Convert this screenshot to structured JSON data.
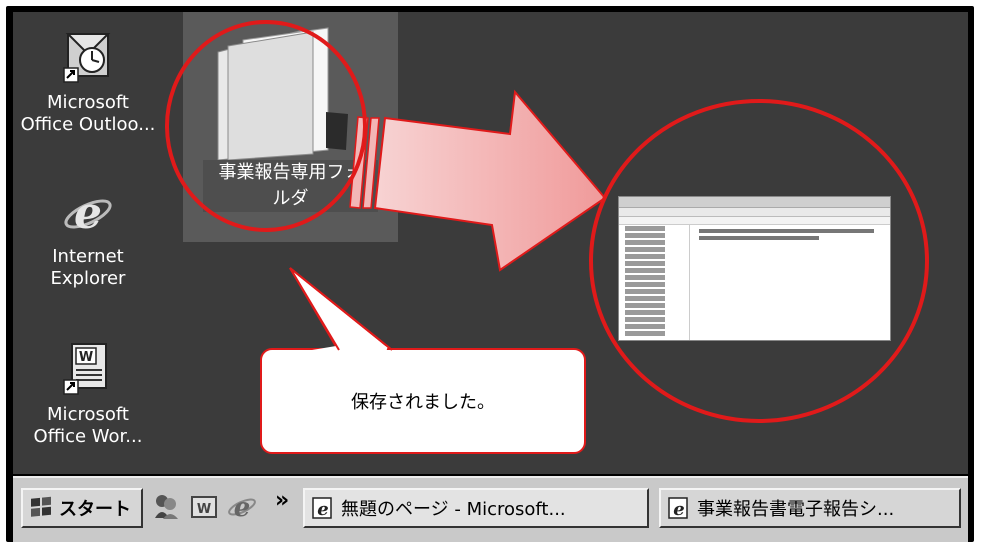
{
  "desktop": {
    "icons": [
      {
        "label_line1": "Microsoft",
        "label_line2": "Office Outloo..."
      },
      {
        "label_line1": "Internet",
        "label_line2": "Explorer"
      },
      {
        "label_line1": "Microsoft",
        "label_line2": "Office Wor..."
      }
    ],
    "folder": {
      "label_line1": "事業報告専用フォ",
      "label_line2": "ルダ"
    }
  },
  "callout": {
    "text": "保存されました。"
  },
  "colors": {
    "annotation_red": "#e01a1a",
    "arrow_fill": "#f3b6b6"
  },
  "taskbar": {
    "start_label": "スタート",
    "overflow_glyph": "»",
    "windows": [
      {
        "label": "無題のページ - Microsoft..."
      },
      {
        "label": "事業報告書電子報告シ..."
      }
    ]
  }
}
